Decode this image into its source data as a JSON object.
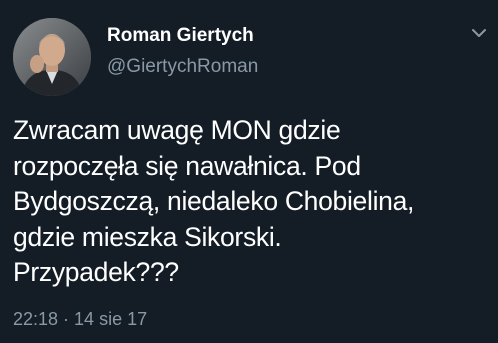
{
  "author": {
    "name": "Roman Giertych",
    "handle": "@GiertychRoman"
  },
  "tweet": {
    "lines": [
      "Zwracam uwagę MON gdzie",
      "rozpoczęła się nawałnica. Pod",
      "Bydgoszczą, niedaleko Chobielina,",
      "gdzie mieszka Sikorski.",
      "Przypadek???"
    ],
    "time": "22:18",
    "separator": "·",
    "date": "14 sie 17"
  },
  "icons": {
    "more": "chevron-down-icon",
    "avatar": "profile-photo"
  },
  "colors": {
    "background": "#141d26",
    "text": "#ffffff",
    "secondary": "#8899a6"
  }
}
